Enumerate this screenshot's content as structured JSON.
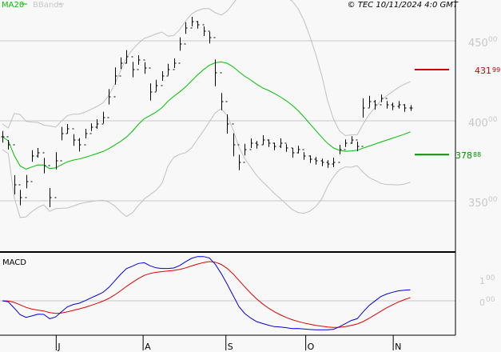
{
  "legend": {
    "ma_label": "MA20",
    "bb_label": "BBands"
  },
  "copyright": "© TEC 10/11/2024 4:0 GMT",
  "colors": {
    "ma": "#00c000",
    "bb": "#c0c0c0",
    "macd": "#0000e0",
    "signal": "#e00000",
    "resistance": "#cc0000",
    "support": "#009000",
    "axis_text": "#c8c8c8"
  },
  "chart_data": [
    {
      "type": "ohlc",
      "title": "",
      "ylim": [
        330,
        470
      ],
      "yticks": [
        {
          "value": 450,
          "main": "450",
          "dec": "00"
        },
        {
          "value": 400,
          "main": "400",
          "dec": "00"
        },
        {
          "value": 350,
          "main": "350",
          "dec": "00"
        }
      ],
      "x_months": [
        {
          "label": "J",
          "bar": 9.1
        },
        {
          "label": "A",
          "bar": 23.8
        },
        {
          "label": "S",
          "bar": 37.8
        },
        {
          "label": "O",
          "bar": 51.3
        },
        {
          "label": "N",
          "bar": 66.1
        }
      ],
      "closes": [
        390,
        385,
        360,
        352,
        362,
        378,
        380,
        372,
        352,
        375,
        392,
        395,
        388,
        385,
        392,
        396,
        398,
        402,
        415,
        428,
        436,
        440,
        432,
        438,
        433,
        418,
        422,
        428,
        432,
        436,
        448,
        458,
        462,
        460,
        456,
        452,
        430,
        412,
        398,
        385,
        374,
        382,
        386,
        385,
        388,
        386,
        384,
        386,
        383,
        380,
        382,
        378,
        376,
        375,
        374,
        373,
        374,
        382,
        386,
        388,
        384,
        408,
        412,
        410,
        414,
        410,
        409,
        410,
        408,
        408
      ],
      "ranges": [
        6,
        5,
        10,
        8,
        7,
        6,
        5,
        8,
        10,
        9,
        7,
        5,
        6,
        7,
        5,
        4,
        5,
        6,
        8,
        9,
        6,
        7,
        8,
        5,
        6,
        9,
        6,
        5,
        6,
        5,
        7,
        6,
        5,
        4,
        5,
        6,
        14,
        9,
        10,
        12,
        8,
        6,
        5,
        4,
        5,
        4,
        4,
        5,
        4,
        5,
        4,
        4,
        4,
        4,
        4,
        4,
        5,
        5,
        4,
        4,
        5,
        10,
        6,
        5,
        4,
        4,
        4,
        4,
        4,
        3
      ],
      "series": [
        {
          "name": "MA20",
          "period": 20
        },
        {
          "name": "BBands",
          "period": 20,
          "stddev": 2
        }
      ],
      "levels": [
        {
          "name": "resistance",
          "value": 431.99,
          "main": "431",
          "dec": "99"
        },
        {
          "name": "support",
          "value": 378.88,
          "main": "378",
          "dec": "88"
        }
      ]
    },
    {
      "type": "line",
      "title": "MACD",
      "ylim": [
        -1.6,
        1.9
      ],
      "yticks": [
        {
          "value": 1,
          "main": "1",
          "dec": "00"
        },
        {
          "value": 0,
          "main": "0",
          "dec": "00"
        }
      ],
      "series": [
        {
          "name": "MACD",
          "fast": 12,
          "slow": 26
        },
        {
          "name": "Signal",
          "period": 9
        }
      ]
    }
  ]
}
